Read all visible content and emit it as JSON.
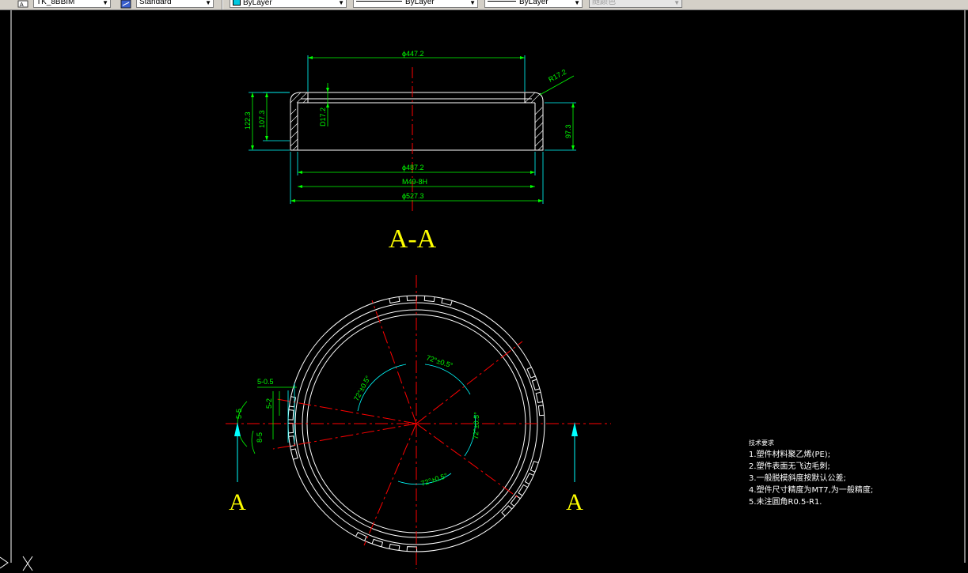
{
  "toolbar": {
    "textstyle": "TK_8BBIM",
    "dimstyle": "Standard",
    "color": "ByLayer",
    "linetype": "ByLayer",
    "lineweight": "ByLayer",
    "plotstyle": "随颜色"
  },
  "drawing": {
    "section_title": "A-A",
    "dims": {
      "top_dia": "ϕ447.2",
      "radius": "R17.2",
      "inner_dia": "ϕ487.2",
      "thread": "M49-8H",
      "outer_dia": "ϕ527.3",
      "h_total": "122.3",
      "h_inner": "107.3",
      "h_right": "97.3",
      "h_lip": "D17.2",
      "ang1": "72°±0.5°",
      "ang2": "72°±0.5°",
      "ang3": "72°±0.5°",
      "ang4": "72°±0.5°",
      "notch_w": "5-0.5",
      "notch_a": "5-5",
      "notch_b": "5-2",
      "notch_c": "8-5"
    },
    "section_mark_left": "A",
    "section_mark_right": "A"
  },
  "notes": {
    "title": "技术要求",
    "items": [
      "1.塑件材料聚乙烯(PE);",
      "2.塑件表面无飞边毛刺;",
      "3.一般脱模斜度按默认公差;",
      "4.塑件尺寸精度为MT7,为一般精度;",
      "5.未注圆角R0.5-R1."
    ]
  },
  "colors": {
    "background": "#000000",
    "geometry": "#ffffff",
    "dimension": "#00ff00",
    "extension": "#00ffff",
    "centerline": "#ff0000",
    "title": "#ffff00"
  }
}
